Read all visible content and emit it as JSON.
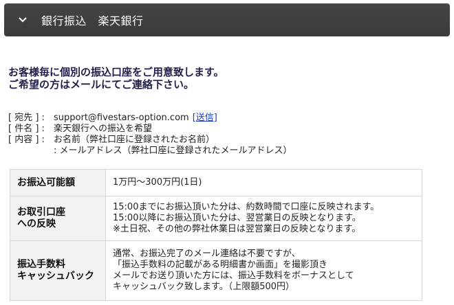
{
  "header": {
    "title": "銀行振込　楽天銀行"
  },
  "intro": {
    "lines": [
      "お客様毎に個別の振込口座をご用意致します。",
      "ご希望の方はメールにてご連絡下さい。"
    ]
  },
  "contact": {
    "to_label": "[ 宛先 ] :",
    "to_value": "support@fivestars-option.com",
    "send_link": "[送信]",
    "subject_label": "[ 件名 ] :",
    "subject_value": "楽天銀行への振込を希望",
    "body_label": "[ 内容 ] :",
    "body_line1": "お名前（弊社口座に登録されたお名前）",
    "body_line2": ": メールアドレス（弊社口座に登録されたメールアドレス）"
  },
  "table": {
    "rows": [
      {
        "header": [
          "お振込可能額"
        ],
        "lines": [
          "1万円～300万円(1日)"
        ]
      },
      {
        "header": [
          "お取引口座",
          "への反映"
        ],
        "lines": [
          "15:00までにお振込頂いた分は、約数時間で口座に反映されます。",
          "15:00以降にお振込頂いた分は、翌営業日の反映となります。",
          "※土日祝、その他の弊社休業日は翌営業日の反映となります。"
        ]
      },
      {
        "header": [
          "振込手数料",
          "キャッシュバック"
        ],
        "lines": [
          "通常、お振込完了のメール連絡は不要ですが、",
          "「振込手数料の記載がある明細書か画面」を撮影頂き",
          "メールでお送り頂いた方には、振込手数料をボーナスとして",
          "キャッシュバック致します。（上限額500円）"
        ]
      }
    ]
  }
}
